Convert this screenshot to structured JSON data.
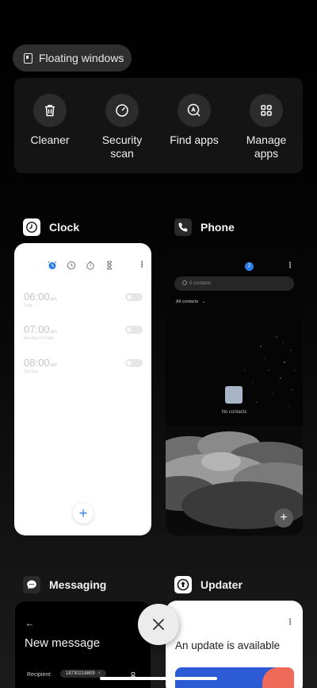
{
  "floating_windows": {
    "label": "Floating windows"
  },
  "quick_actions": [
    {
      "label": "Cleaner",
      "icon": "trash-icon"
    },
    {
      "label": "Security\nscan",
      "icon": "gauge-icon"
    },
    {
      "label": "Find apps",
      "icon": "search-apps-icon"
    },
    {
      "label": "Manage\napps",
      "icon": "grid-icon"
    }
  ],
  "apps": {
    "clock": {
      "name": "Clock",
      "alarms": [
        {
          "time": "06:00",
          "ampm": "am",
          "repeat": "Daily"
        },
        {
          "time": "07:00",
          "ampm": "am",
          "repeat": "Monday to Friday"
        },
        {
          "time": "08:00",
          "ampm": "am",
          "repeat": "Sat Sun"
        }
      ],
      "fab": "+"
    },
    "phone": {
      "name": "Phone",
      "badge": "2",
      "search_placeholder": "0 contacts",
      "filter": "All contacts",
      "empty_text": "No contacts",
      "fab": "+"
    },
    "messaging": {
      "name": "Messaging",
      "title": "New message",
      "recipient_label": "Recipient:",
      "recipient_value": "18730218809"
    },
    "updater": {
      "name": "Updater",
      "title": "An update is available"
    }
  },
  "colors": {
    "accent_blue": "#2b7de8",
    "background": "#000000",
    "panel": "#141414"
  }
}
